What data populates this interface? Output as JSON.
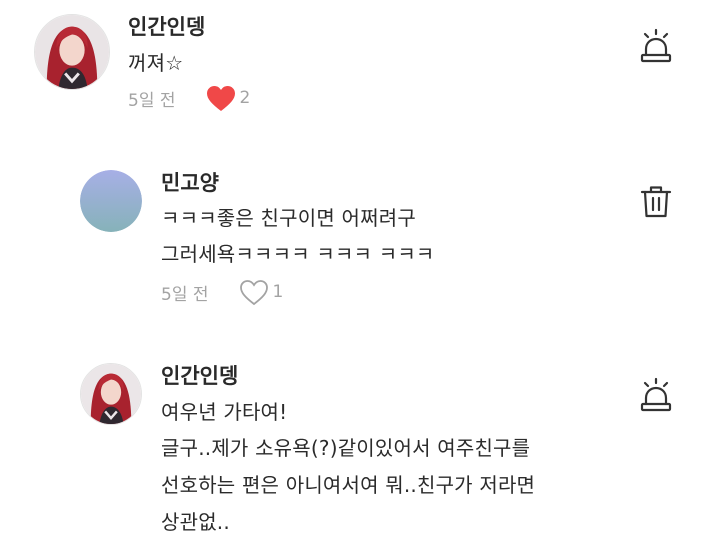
{
  "comments": [
    {
      "author": "인간인뎅",
      "lines": [
        "꺼져☆"
      ],
      "time": "5일 전",
      "likes": "2",
      "liked": true,
      "action_icon": "siren-icon",
      "avatar": "profile-photo-red-hair"
    },
    {
      "author": "민고양",
      "lines": [
        "ㅋㅋㅋ좋은 친구이면 어쩌려구",
        "그러세욕ㅋㅋㅋㅋ ㅋㅋㅋ ㅋㅋㅋ"
      ],
      "time": "5일 전",
      "likes": "1",
      "liked": false,
      "action_icon": "trash-icon",
      "avatar": "gradient-default-avatar"
    },
    {
      "author": "인간인뎅",
      "lines": [
        "여우년 가타여!",
        "글구..제가 소유욕(?)같이있어서 여주친구를",
        "선호하는 편은 아니여서여 뭐..친구가 저라면",
        "상관없.."
      ],
      "action_icon": "siren-icon",
      "avatar": "profile-photo-red-hair"
    }
  ],
  "colors": {
    "heart_filled": "#f04848",
    "meta_text": "#a3a3a3",
    "author_text": "#2a2a2a"
  }
}
